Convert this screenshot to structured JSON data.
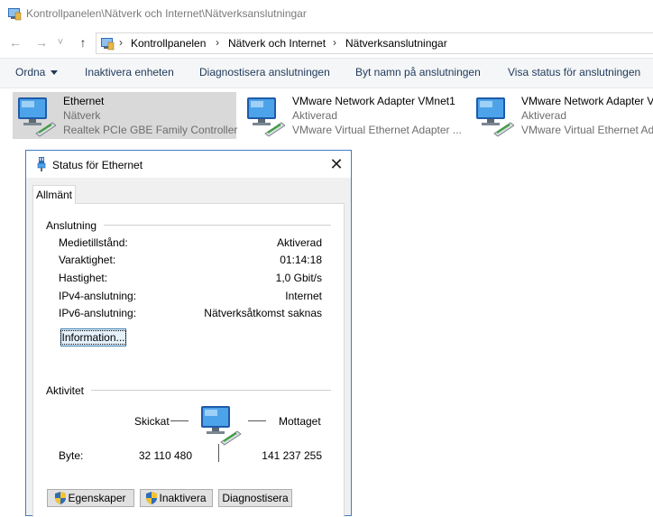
{
  "window": {
    "title": "Kontrollpanelen\\Nätverk och Internet\\Nätverksanslutningar",
    "icon": "control-panel-icon"
  },
  "nav": {
    "back": "←",
    "forward": "→",
    "recent": "˅",
    "up": "↑",
    "breadcrumbs": [
      "Kontrollpanelen",
      "Nätverk och Internet",
      "Nätverksanslutningar"
    ],
    "separator": "›"
  },
  "commands": {
    "organize": "Ordna",
    "disable_device": "Inaktivera enheten",
    "diagnose": "Diagnostisera anslutningen",
    "rename": "Byt namn på anslutningen",
    "view_status": "Visa status för anslutningen"
  },
  "adapters": [
    {
      "name": "Ethernet",
      "status": "Nätverk",
      "device": "Realtek PCIe GBE Family Controller"
    },
    {
      "name": "VMware Network Adapter VMnet1",
      "status": "Aktiverad",
      "device": "VMware Virtual Ethernet Adapter ..."
    },
    {
      "name": "VMware Network Adapter V",
      "status": "Aktiverad",
      "device": "VMware Virtual Ethernet Ad"
    }
  ],
  "dialog": {
    "title": "Status för Ethernet",
    "close": "✕",
    "tab": "Allmänt",
    "connection": {
      "heading": "Anslutning",
      "rows": [
        {
          "label": "Medietillstånd:",
          "value": "Aktiverad"
        },
        {
          "label": "Varaktighet:",
          "value": "01:14:18"
        },
        {
          "label": "Hastighet:",
          "value": "1,0 Gbit/s"
        },
        {
          "label": "IPv4-anslutning:",
          "value": "Internet"
        },
        {
          "label": "IPv6-anslutning:",
          "value": "Nätverksåtkomst saknas"
        }
      ],
      "details_button": "Information..."
    },
    "activity": {
      "heading": "Aktivitet",
      "sent_label": "Skickat",
      "received_label": "Mottaget",
      "bytes_label": "Byte:",
      "bytes_sent": "32 110 480",
      "bytes_received": "141 237 255"
    },
    "buttons": {
      "properties": "Egenskaper",
      "disable": "Inaktivera",
      "diagnose": "Diagnostisera"
    }
  },
  "colors": {
    "accent": "#3f7cc6",
    "command_text": "#1e395b",
    "selected_tile": "#d9d9d9"
  }
}
